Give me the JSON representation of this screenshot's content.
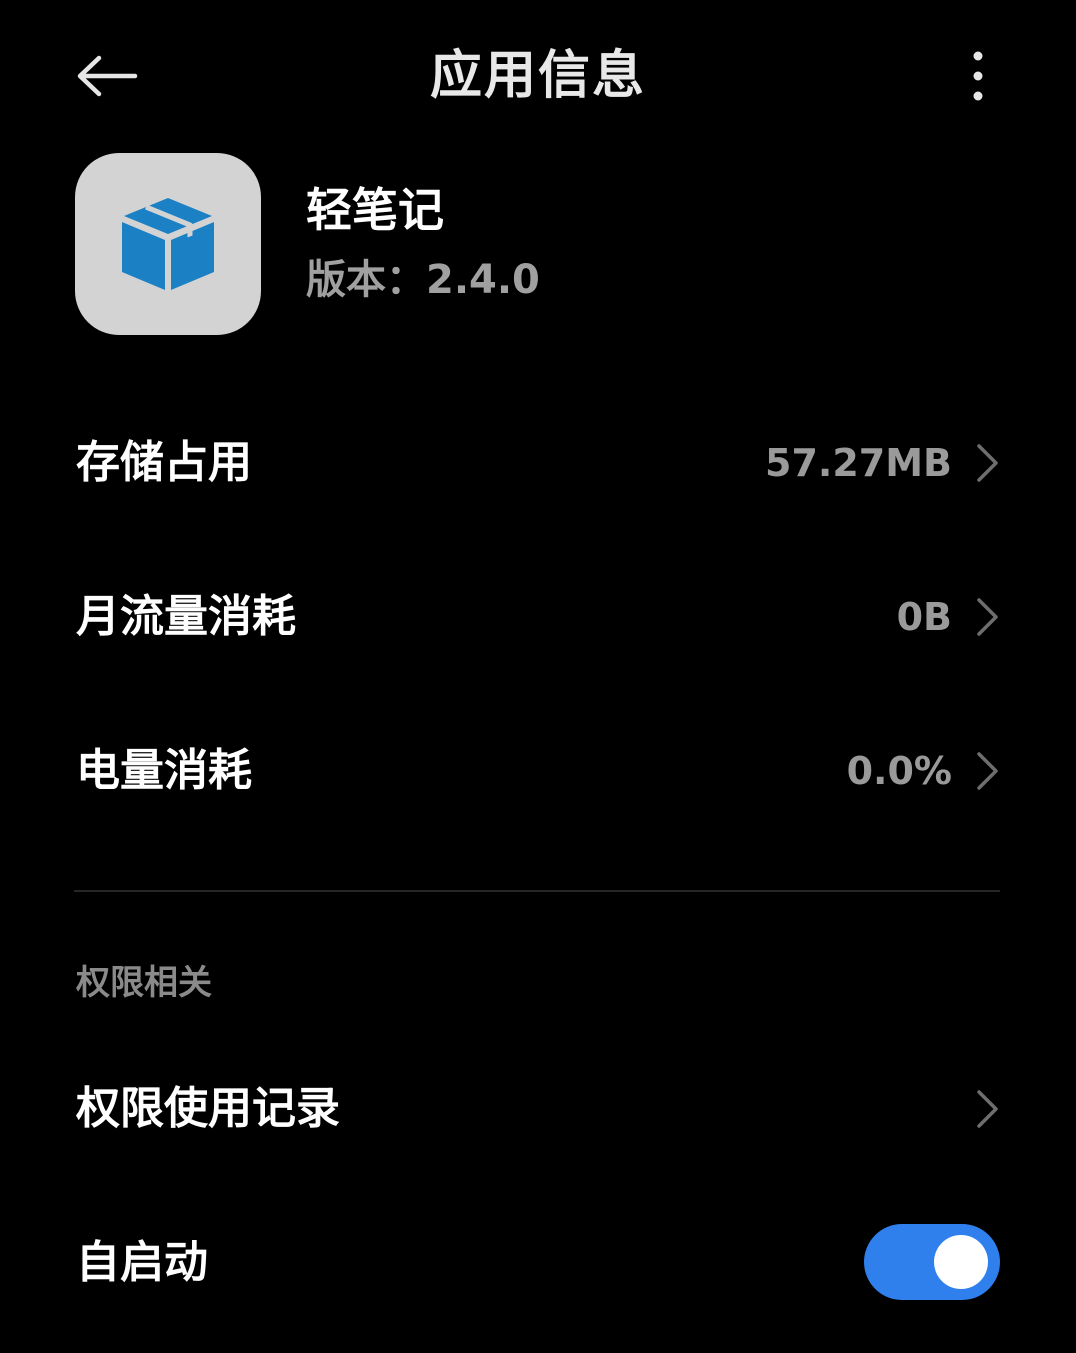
{
  "header": {
    "title": "应用信息",
    "back_icon": "arrow-left-icon",
    "more_icon": "more-vertical-icon"
  },
  "app": {
    "name": "轻笔记",
    "version_label": "版本：",
    "version": "2.4.0",
    "icon": "package-box-icon",
    "icon_color": "#1b80c4",
    "icon_background": "#d3d3d3"
  },
  "info_rows": [
    {
      "label": "存储占用",
      "value": "57.27MB"
    },
    {
      "label": "月流量消耗",
      "value": "0B"
    },
    {
      "label": "电量消耗",
      "value": "0.0%"
    }
  ],
  "permissions": {
    "section_title": "权限相关",
    "usage_record_label": "权限使用记录",
    "autostart_label": "自启动",
    "autostart_enabled": true
  },
  "colors": {
    "background": "#000000",
    "accent": "#2f80ed",
    "secondary_text": "#9a9a9a"
  }
}
